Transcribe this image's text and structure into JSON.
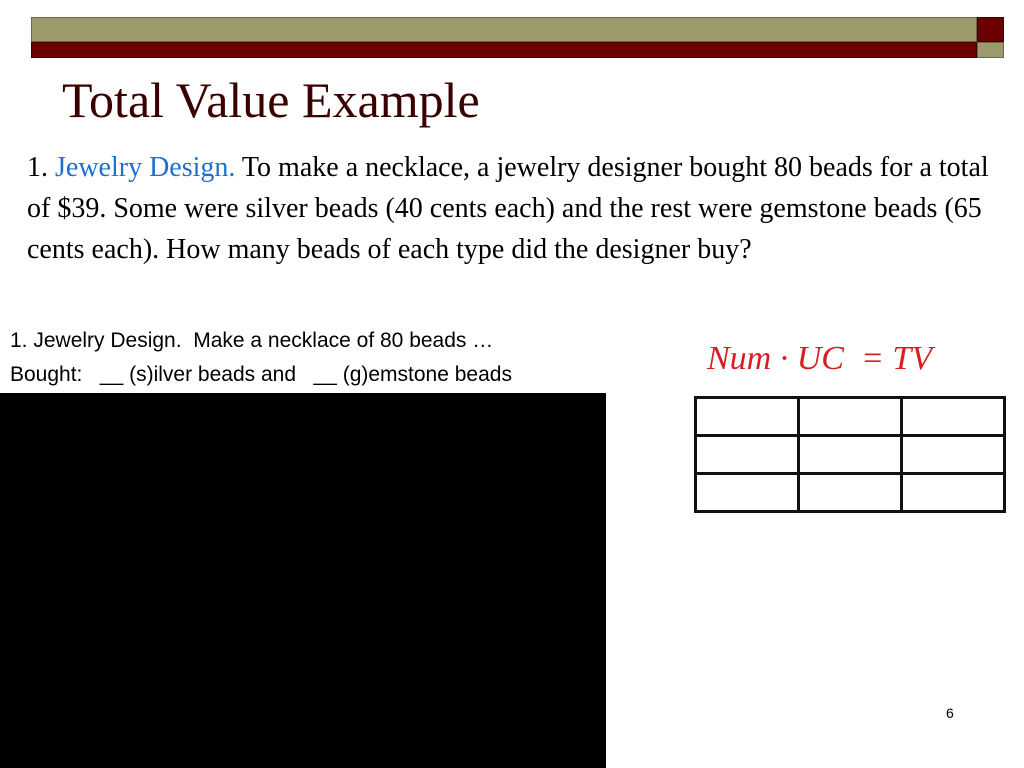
{
  "slide": {
    "title": "Total Value Example",
    "problem": {
      "number": "1.",
      "name": "Jewelry Design.",
      "text": "To make a necklace, a jewelry designer bought 80 beads for a total of $39.  Some were silver beads (40 cents each) and the rest were gemstone beads (65 cents each).  How many beads of each type did the designer buy?"
    },
    "summary": {
      "line1": "1. Jewelry Design.  Make a necklace of 80 beads …",
      "line2": "Bought:   __ (s)ilver beads and   __ (g)emstone beads"
    },
    "formula": "Num · UC  = TV",
    "table": {
      "rows": [
        [
          "",
          "",
          ""
        ],
        [
          "",
          "",
          ""
        ],
        [
          "",
          "",
          ""
        ]
      ]
    },
    "page_number": "6"
  },
  "colors": {
    "title": "#3a0000",
    "accent": "#1f6fd1",
    "formula": "#d42020",
    "band_olive": "#9c9a6c",
    "band_red": "#6b0000"
  }
}
